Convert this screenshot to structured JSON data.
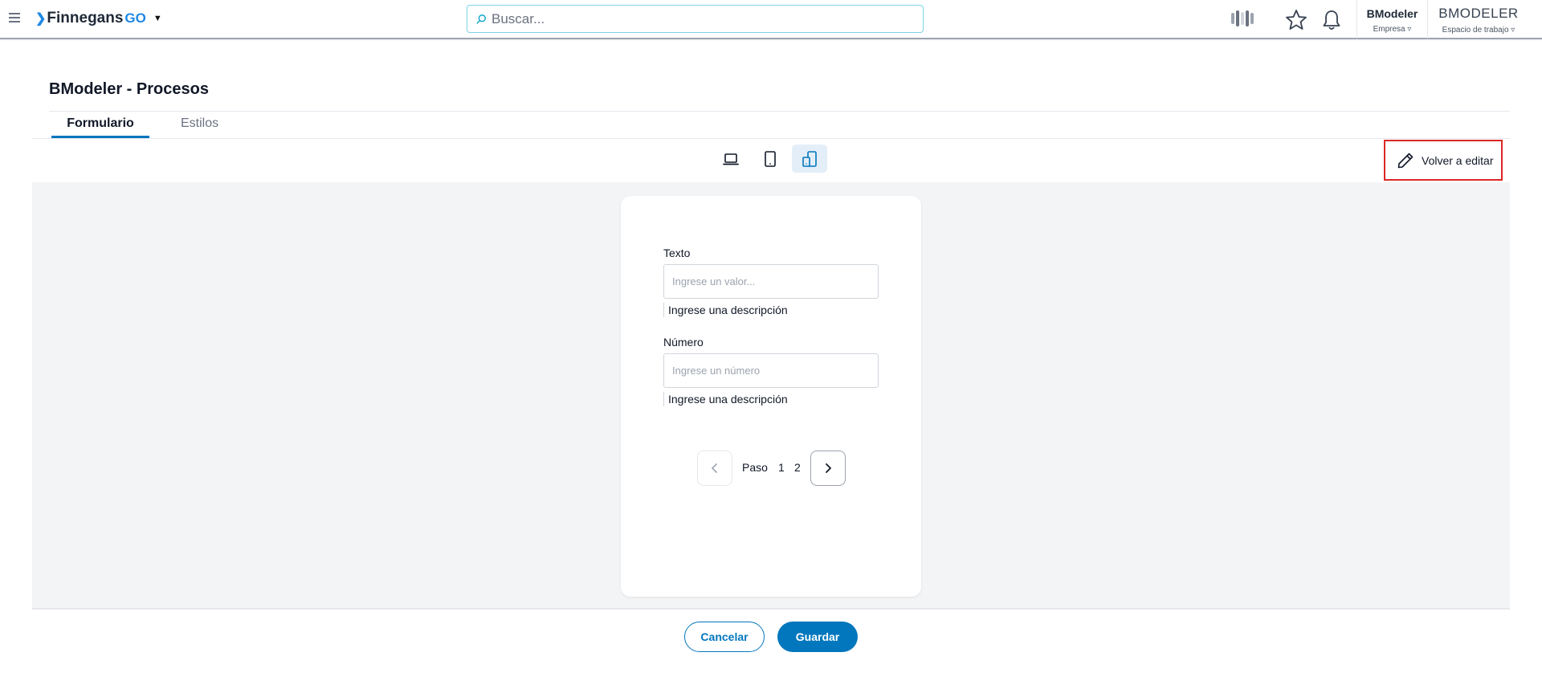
{
  "header": {
    "logo_text": "Finnegans",
    "logo_suffix": "GO",
    "search_placeholder": "Buscar...",
    "company": {
      "name": "BModeler",
      "label": "Empresa ▿"
    },
    "workspace": {
      "name": "BMODELER",
      "label": "Espacio de trabajo ▿"
    }
  },
  "page": {
    "title": "BModeler - Procesos",
    "tabs": [
      {
        "label": "Formulario",
        "active": true
      },
      {
        "label": "Estilos",
        "active": false
      }
    ]
  },
  "toolbar": {
    "devices": [
      "laptop-icon",
      "tablet-icon",
      "mobile-icon"
    ],
    "active_device": "mobile-icon",
    "edit_label": "Volver a editar"
  },
  "form": {
    "fields": [
      {
        "label": "Texto",
        "placeholder": "Ingrese un valor...",
        "value": "",
        "description": "Ingrese una descripción"
      },
      {
        "label": "Número",
        "placeholder": "Ingrese un número",
        "value": "",
        "description": "Ingrese una descripción"
      }
    ],
    "pager": {
      "label": "Paso",
      "pages": [
        "1",
        "2"
      ]
    }
  },
  "actions": {
    "cancel_label": "Cancelar",
    "save_label": "Guardar"
  },
  "colors": {
    "accent": "#0277bd",
    "logo_blue": "#1e88e5",
    "highlight_border": "#dc2626",
    "canvas_bg": "#f3f4f6"
  }
}
